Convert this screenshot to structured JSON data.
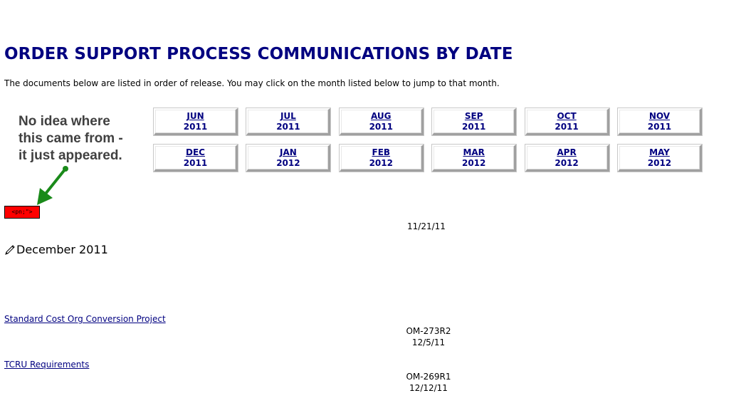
{
  "page": {
    "title": "ORDER SUPPORT PROCESS COMMUNICATIONS BY DATE",
    "intro": "The documents below are listed in order of release.  You may click on the month listed below to jump to that month."
  },
  "annotation": {
    "lines": [
      "No idea where",
      "this came from -",
      "it just appeared."
    ],
    "red_tag_text": "<pn;\">",
    "arrow_color": "#1a8a1a"
  },
  "months": [
    {
      "month": "JUN",
      "year": "2011"
    },
    {
      "month": "JUL",
      "year": "2011"
    },
    {
      "month": "AUG",
      "year": "2011"
    },
    {
      "month": "SEP",
      "year": "2011"
    },
    {
      "month": "OCT",
      "year": "2011"
    },
    {
      "month": "NOV",
      "year": "2011"
    },
    {
      "month": "DEC",
      "year": "2011"
    },
    {
      "month": "JAN",
      "year": "2012"
    },
    {
      "month": "FEB",
      "year": "2012"
    },
    {
      "month": "MAR",
      "year": "2012"
    },
    {
      "month": "APR",
      "year": "2012"
    },
    {
      "month": "MAY",
      "year": "2012"
    }
  ],
  "top_date": "11/21/11",
  "section": {
    "heading": "December 2011",
    "icon": "anchor-pencil-icon"
  },
  "documents": [
    {
      "title": "Standard Cost Org Conversion Project",
      "code": "OM-273R2",
      "date": "12/5/11"
    },
    {
      "title": "TCRU Requirements",
      "code": "OM-269R1",
      "date": "12/12/11"
    }
  ],
  "colors": {
    "title": "#000080",
    "link": "#000080",
    "annotation_text": "#404040",
    "red_tag": "#ff0000"
  }
}
